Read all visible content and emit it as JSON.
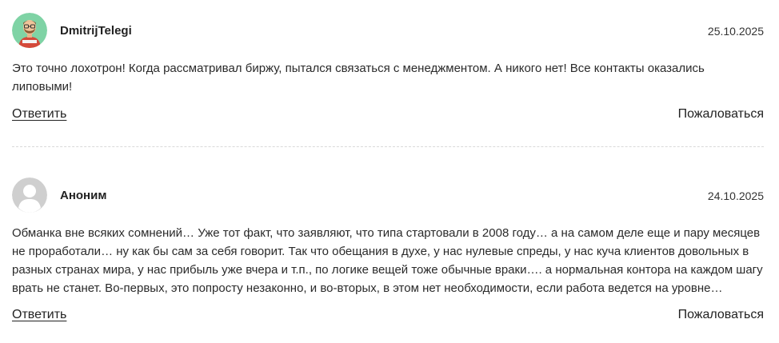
{
  "comments": [
    {
      "author": "DmitrijTelegi",
      "date": "25.10.2025",
      "avatar_icon": "user-photo-avatar",
      "text": "Это точно лохотрон! Когда рассматривал биржу, пытался связаться с менеджментом. А никого нет! Все контакты оказались липовыми!",
      "reply_label": "Ответить",
      "complain_label": "Пожаловаться"
    },
    {
      "author": "Аноним",
      "date": "24.10.2025",
      "avatar_icon": "default-user-avatar",
      "text": "Обманка вне всяких сомнений… Уже тот факт, что заявляют, что типа стартовали в 2008 году… а на самом деле еще и пару месяцев не проработали… ну как бы сам за себя говорит. Так что обещания в духе, у нас нулевые спреды, у нас куча клиентов довольных в разных странах мира, у нас прибыль уже вчера и т.п., по логике вещей тоже обычные враки…. а нормальная контора на каждом шагу врать не станет. Во-первых, это попросту незаконно, и во-вторых, в этом нет необходимости, если работа ведется на уровне…",
      "reply_label": "Ответить",
      "complain_label": "Пожаловаться"
    }
  ],
  "colors": {
    "text": "#222222",
    "divider": "#d9d9d9",
    "avatar_green": "#7fd3a5",
    "avatar_gray": "#cfcfcf"
  }
}
